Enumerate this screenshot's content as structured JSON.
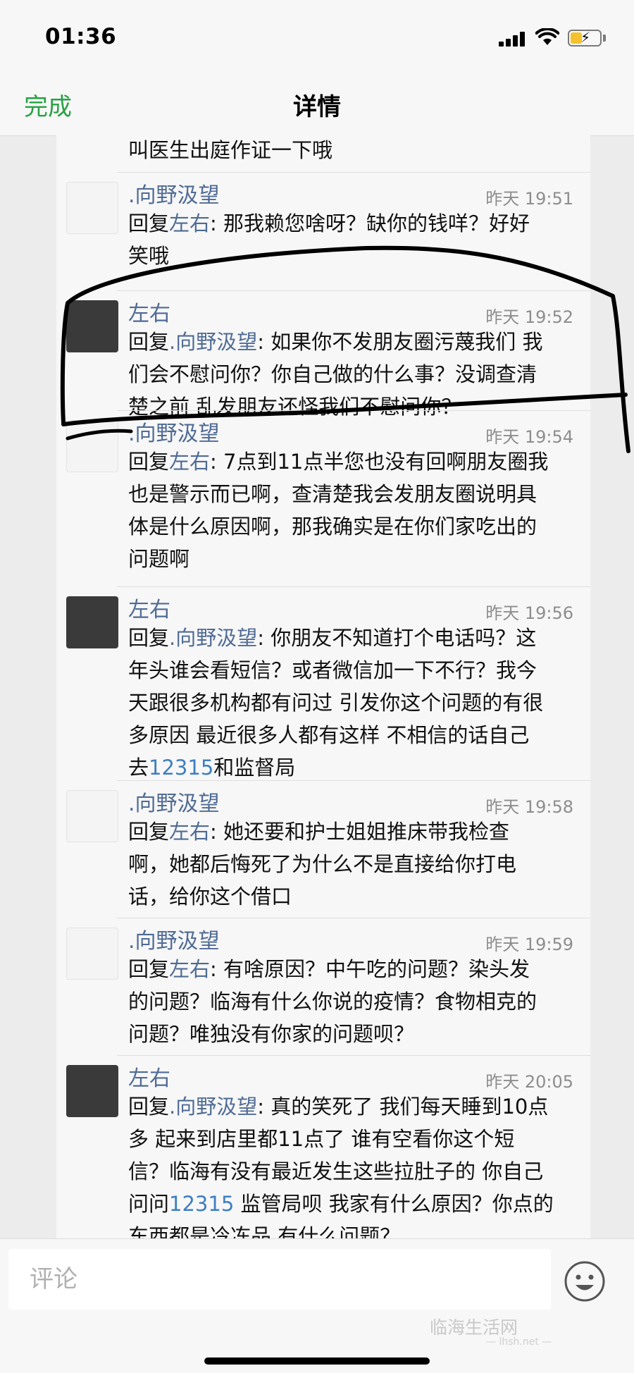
{
  "status_bar": {
    "time": "01:36"
  },
  "nav": {
    "done_label": "完成",
    "title": "详情"
  },
  "cut_off_text": "叫医生出庭作证一下哦",
  "comments": [
    {
      "author": ".向野汲望",
      "time": "昨天 19:51",
      "avatar": "light",
      "prefix": "回复",
      "reply_to": "左右",
      "sep": ": ",
      "lines": [
        "那我赖您啥呀？缺你的钱咩？好好",
        "笑哦"
      ]
    },
    {
      "author": "左右",
      "time": "昨天 19:52",
      "avatar": "dark",
      "prefix": "回复",
      "reply_to": ".向野汲望",
      "sep": ": ",
      "lines": [
        "如果你不发朋友圈污蔑我们 我",
        "们会不慰问你？你自己做的什么事？没调查清",
        "楚之前 乱发朋友还怪我们不慰问你？"
      ]
    },
    {
      "author": ".向野汲望",
      "time": "昨天 19:54",
      "avatar": "light",
      "prefix": "回复",
      "reply_to": "左右",
      "sep": ": ",
      "lines": [
        "7点到11点半您也没有回啊朋友圈我",
        "也是警示而已啊，查清楚我会发朋友圈说明具",
        "体是什么原因啊，那我确实是在你们家吃出的",
        "问题啊"
      ]
    },
    {
      "author": "左右",
      "time": "昨天 19:56",
      "avatar": "dark",
      "prefix": "回复",
      "reply_to": ".向野汲望",
      "sep": ": ",
      "lines": [
        "你朋友不知道打个电话吗？这",
        "年头谁会看短信？或者微信加一下不行？我今",
        "天跟很多机构都有问过 引发你这个问题的有很",
        "多原因 最近很多人都有这样 不相信的话自己"
      ],
      "last_line": {
        "before": "去",
        "number": "12315",
        "after": "和监督局"
      }
    },
    {
      "author": ".向野汲望",
      "time": "昨天 19:58",
      "avatar": "light",
      "prefix": "回复",
      "reply_to": "左右",
      "sep": ": ",
      "lines": [
        "她还要和护士姐姐推床带我检查",
        "啊，她都后悔死了为什么不是直接给你打电",
        "话，给你这个借口"
      ]
    },
    {
      "author": ".向野汲望",
      "time": "昨天 19:59",
      "avatar": "light",
      "prefix": "回复",
      "reply_to": "左右",
      "sep": ": ",
      "lines": [
        "有啥原因？中午吃的问题？染头发",
        "的问题？临海有什么你说的疫情？食物相克的",
        "问题？唯独没有你家的问题呗？"
      ]
    },
    {
      "author": "左右",
      "time": "昨天 20:05",
      "avatar": "dark",
      "prefix": "回复",
      "reply_to": ".向野汲望",
      "sep": ": ",
      "lines": [
        "真的笑死了 我们每天睡到10点",
        "多 起来到店里都11点了 谁有空看你这个短",
        "信？临海有没有最近发生这些拉肚子的 你自己"
      ],
      "mid_line": {
        "before": "问问",
        "number": "12315",
        "after": " 监管局呗 我家有什么原因？你点的"
      },
      "tail_line": "东西都是冷冻品 有什么问题？"
    }
  ],
  "bottom_bar": {
    "placeholder": "评论",
    "emoji_icon": "smiley-face-icon",
    "watermark": "临海生活网",
    "watermark_sub": "— lhsh.net —"
  },
  "colors": {
    "accent_green": "#27a243",
    "link_blue": "#4f6b95",
    "number_blue": "#3e7fc1",
    "battery_yellow": "#f3c22d"
  },
  "battery_level": 0.4
}
